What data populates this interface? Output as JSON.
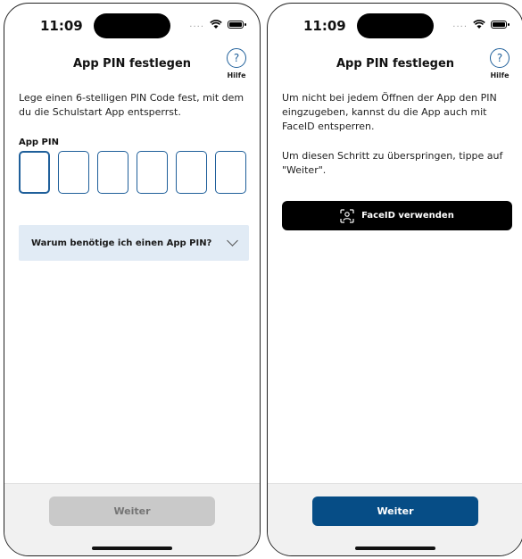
{
  "status": {
    "time": "11:09"
  },
  "left": {
    "title": "App PIN festlegen",
    "help_label": "Hilfe",
    "help_symbol": "?",
    "intro": "Lege einen 6-stelligen PIN Code fest, mit dem du die Schulstart App entsperrst.",
    "pin_label": "App PIN",
    "pin_slots": [
      "",
      "",
      "",
      "",
      "",
      ""
    ],
    "accordion_title": "Warum benötige ich einen App PIN?",
    "button_label": "Weiter"
  },
  "right": {
    "title": "App PIN festlegen",
    "help_label": "Hilfe",
    "help_symbol": "?",
    "paragraph1": "Um nicht bei jedem Öffnen der App den PIN eingzugeben, kannst du die App auch mit FaceID entsperren.",
    "paragraph2": "Um diesen Schritt zu überspringen, tippe auf \"Weiter\".",
    "faceid_button": "FaceID verwenden",
    "button_label": "Weiter"
  },
  "colors": {
    "accent": "#1f5f9a",
    "primary_button": "#064d86",
    "accordion_bg": "#e1ebf5",
    "disabled_button": "#c9c9c9"
  },
  "icons": [
    "help-icon",
    "wifi-icon",
    "battery-icon",
    "chevron-down-icon",
    "face-id-icon"
  ]
}
